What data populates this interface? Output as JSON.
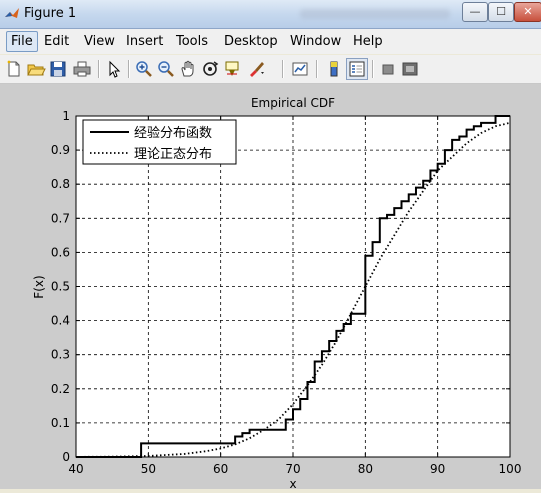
{
  "window": {
    "title": "Figure 1",
    "minimize_label": "—",
    "maximize_label": "☐",
    "close_label": "✕"
  },
  "menu": [
    "File",
    "Edit",
    "View",
    "Insert",
    "Tools",
    "Desktop",
    "Window",
    "Help"
  ],
  "toolbar_icons": [
    "new-figure-icon",
    "open-file-icon",
    "save-icon",
    "print-icon",
    "pointer-icon",
    "zoom-in-icon",
    "zoom-out-icon",
    "pan-icon",
    "rotate-icon",
    "data-cursor-icon",
    "brush-icon",
    "link-plot-icon",
    "colorbar-icon",
    "legend-icon",
    "hide-plot-tools-icon",
    "show-plot-tools-icon"
  ],
  "colors": {
    "figure_bg": "#cccccc",
    "axes_bg": "#ffffff",
    "line": "#000000"
  },
  "chart_data": {
    "type": "line",
    "title": "Empirical CDF",
    "xlabel": "x",
    "ylabel": "F(x)",
    "xlim": [
      40,
      100
    ],
    "ylim": [
      0,
      1
    ],
    "xticks": [
      40,
      50,
      60,
      70,
      80,
      90,
      100
    ],
    "yticks": [
      0,
      0.1,
      0.2,
      0.3,
      0.4,
      0.5,
      0.6,
      0.7,
      0.8,
      0.9,
      1
    ],
    "grid": true,
    "legend_position": "top-left",
    "series": [
      {
        "name": "经验分布函数",
        "style": "solid-step",
        "x": [
          40,
          49,
          62,
          63,
          64,
          69,
          70,
          71,
          72,
          73,
          74,
          75,
          76,
          77,
          78,
          80,
          81,
          82,
          83,
          84,
          85,
          86,
          87,
          88,
          89,
          90,
          91,
          92,
          93,
          94,
          95,
          96,
          98,
          100
        ],
        "y": [
          0,
          0.04,
          0.06,
          0.07,
          0.08,
          0.11,
          0.14,
          0.17,
          0.22,
          0.28,
          0.31,
          0.34,
          0.37,
          0.39,
          0.42,
          0.59,
          0.63,
          0.7,
          0.71,
          0.73,
          0.75,
          0.77,
          0.79,
          0.81,
          0.84,
          0.86,
          0.9,
          0.93,
          0.94,
          0.96,
          0.97,
          0.98,
          1.0,
          1.0
        ]
      },
      {
        "name": "理论正态分布",
        "style": "dotted",
        "x": [
          40,
          45,
          50,
          55,
          58,
          60,
          62,
          64,
          66,
          68,
          70,
          72,
          74,
          76,
          78,
          80,
          82,
          84,
          86,
          88,
          90,
          92,
          94,
          96,
          98,
          100
        ],
        "y": [
          0.0003,
          0.001,
          0.003,
          0.009,
          0.017,
          0.025,
          0.037,
          0.055,
          0.08,
          0.11,
          0.155,
          0.21,
          0.27,
          0.34,
          0.42,
          0.5,
          0.58,
          0.65,
          0.72,
          0.78,
          0.84,
          0.88,
          0.92,
          0.95,
          0.97,
          0.98
        ]
      }
    ]
  }
}
